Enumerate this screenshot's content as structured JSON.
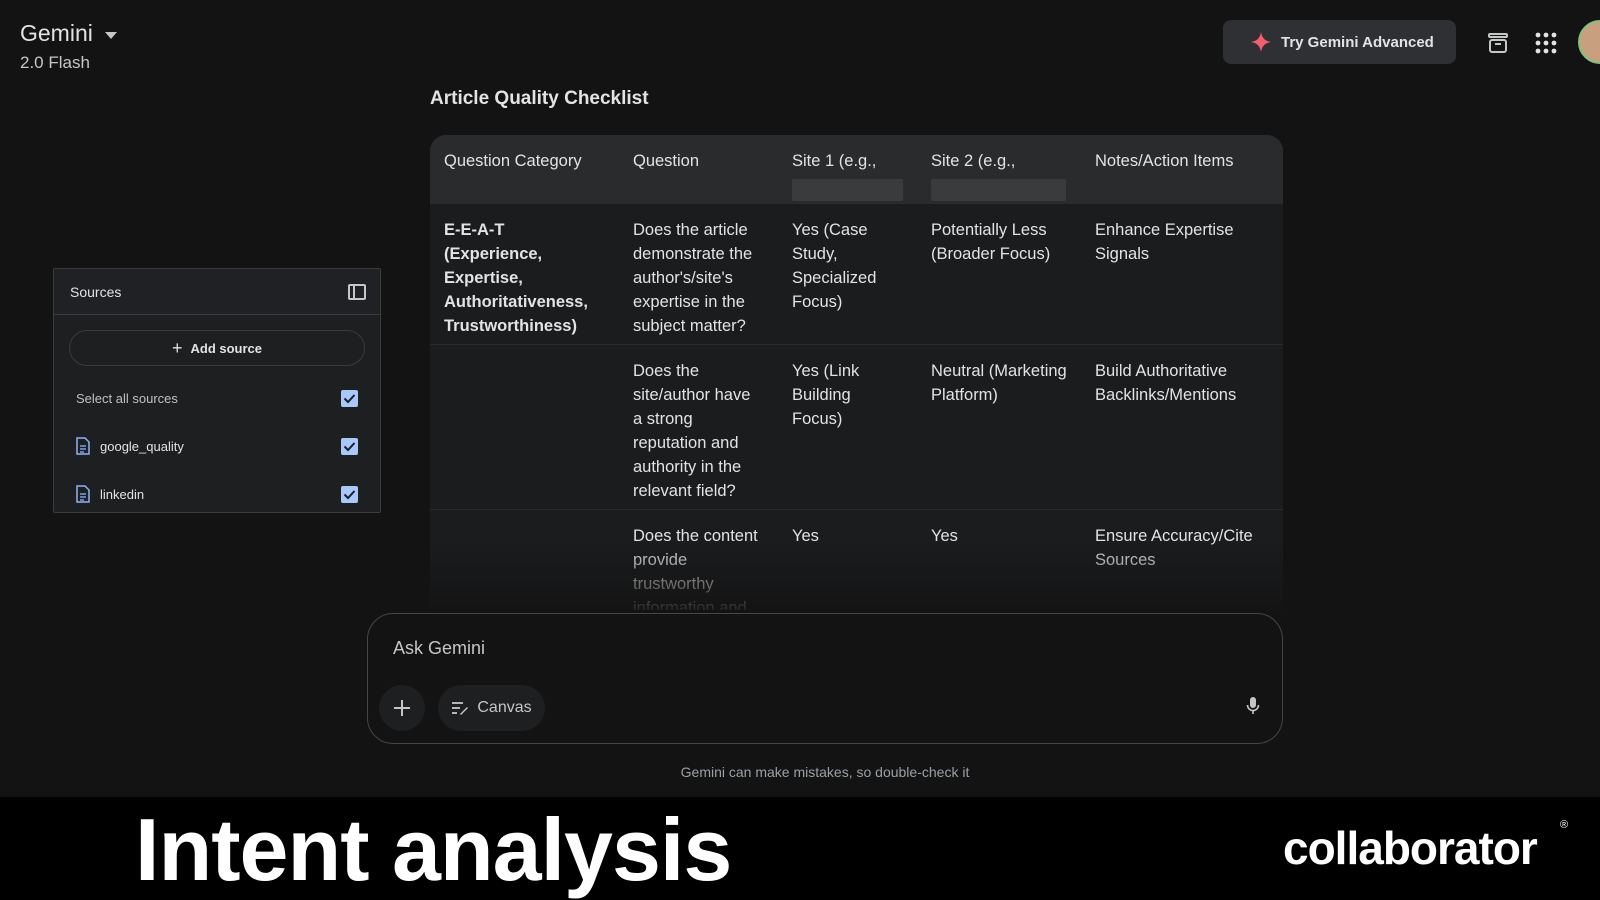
{
  "header": {
    "app_name": "Gemini",
    "model": "2.0 Flash",
    "try_advanced": "Try Gemini Advanced"
  },
  "checklist": {
    "title": "Article Quality Checklist",
    "columns": [
      "Question Category",
      "Question",
      "Site 1 (e.g.,",
      "Site 2 (e.g.,",
      "Notes/Action Items"
    ],
    "rows": [
      {
        "category": "E-E-A-T (Experience, Expertise, Authoritativeness, Trustworthiness)",
        "question": "Does the article demonstrate the author's/site's expertise in the subject matter?",
        "site1": "Yes (Case Study, Specialized Focus)",
        "site2": "Potentially Less (Broader Focus)",
        "notes": "Enhance Expertise Signals"
      },
      {
        "category": "",
        "question": "Does the site/author have a strong reputation and authority in the relevant field?",
        "site1": "Yes (Link Building Focus)",
        "site2": "Neutral (Marketing Platform)",
        "notes": "Build Authoritative Backlinks/Mentions"
      },
      {
        "category": "",
        "question": "Does the content provide trustworthy information and",
        "site1": "Yes",
        "site2": "Yes",
        "notes": "Ensure Accuracy/Cite Sources"
      }
    ]
  },
  "sources": {
    "title": "Sources",
    "add_label": "Add source",
    "select_all": "Select all sources",
    "items": [
      {
        "name": "google_quality"
      },
      {
        "name": "linkedin"
      }
    ]
  },
  "input": {
    "placeholder": "Ask Gemini",
    "canvas": "Canvas"
  },
  "disclaimer": "Gemini can make mistakes, so double-check it",
  "banner": {
    "headline": "Intent analysis",
    "brand": "collaborator",
    "reg_mark": "®"
  },
  "colors": {
    "background": "#131314",
    "accent_checkbox": "#a8c7fa",
    "spark": "#f25e6b"
  }
}
